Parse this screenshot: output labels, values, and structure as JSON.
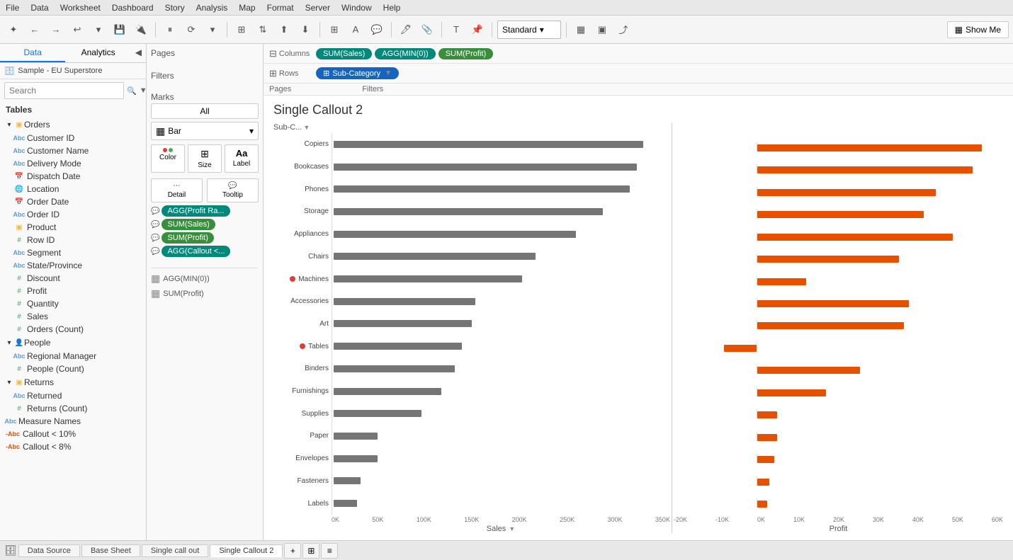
{
  "menu": {
    "items": [
      "File",
      "Data",
      "Worksheet",
      "Dashboard",
      "Story",
      "Analysis",
      "Map",
      "Format",
      "Server",
      "Window",
      "Help"
    ]
  },
  "toolbar": {
    "standard_label": "Standard",
    "show_me_label": "Show Me"
  },
  "left_panel": {
    "tabs": [
      "Data",
      "Analytics"
    ],
    "data_source": "Sample - EU Superstore",
    "search_placeholder": "Search",
    "tables_header": "Tables",
    "orders": {
      "group_label": "Orders",
      "items": [
        {
          "label": "Customer ID",
          "type": "abc"
        },
        {
          "label": "Customer Name",
          "type": "abc"
        },
        {
          "label": "Delivery Mode",
          "type": "abc"
        },
        {
          "label": "Dispatch Date",
          "type": "calendar"
        },
        {
          "label": "Location",
          "type": "globe"
        },
        {
          "label": "Order Date",
          "type": "calendar"
        },
        {
          "label": "Order ID",
          "type": "abc"
        },
        {
          "label": "Product",
          "type": "folder"
        },
        {
          "label": "Row ID",
          "type": "hash"
        },
        {
          "label": "Segment",
          "type": "abc"
        },
        {
          "label": "State/Province",
          "type": "abc"
        },
        {
          "label": "Discount",
          "type": "hash"
        },
        {
          "label": "Profit",
          "type": "hash"
        },
        {
          "label": "Quantity",
          "type": "hash"
        },
        {
          "label": "Sales",
          "type": "hash"
        },
        {
          "label": "Orders (Count)",
          "type": "hash"
        }
      ]
    },
    "people": {
      "group_label": "People",
      "items": [
        {
          "label": "Regional Manager",
          "type": "abc"
        },
        {
          "label": "People (Count)",
          "type": "hash"
        }
      ]
    },
    "returns": {
      "group_label": "Returns",
      "items": [
        {
          "label": "Returned",
          "type": "abc"
        },
        {
          "label": "Returns (Count)",
          "type": "hash"
        }
      ]
    },
    "extra": [
      {
        "label": "Measure Names",
        "type": "abc"
      },
      {
        "label": "Callout < 10%",
        "type": "abc-calc"
      },
      {
        "label": "Callout < 8%",
        "type": "abc-calc"
      }
    ]
  },
  "middle_panel": {
    "pages_label": "Pages",
    "filters_label": "Filters",
    "marks_label": "Marks",
    "marks_all": "All",
    "mark_type": "Bar",
    "mark_buttons": [
      {
        "label": "Color",
        "icon": "⬤⬤"
      },
      {
        "label": "Size",
        "icon": "⊞"
      },
      {
        "label": "Label",
        "icon": "Aa"
      },
      {
        "label": "Detail",
        "icon": "⋯"
      },
      {
        "label": "Tooltip",
        "icon": "💬"
      }
    ],
    "pills": [
      {
        "label": "AGG(Profit Ra...",
        "color": "teal"
      },
      {
        "label": "SUM(Sales)",
        "color": "green"
      },
      {
        "label": "SUM(Profit)",
        "color": "green"
      },
      {
        "label": "AGG(Callout <...",
        "color": "teal"
      }
    ],
    "agg_items": [
      "AGG(MIN(0))",
      "SUM(Profit)"
    ]
  },
  "chart": {
    "title": "Single Callout 2",
    "columns_label": "Columns",
    "rows_label": "Rows",
    "columns_pills": [
      {
        "label": "SUM(Sales)",
        "color": "teal"
      },
      {
        "label": "AGG(MIN(0))",
        "color": "teal"
      },
      {
        "label": "SUM(Profit)",
        "color": "green"
      }
    ],
    "rows_pills": [
      {
        "label": "Sub-Category",
        "color": "blue",
        "has_filter": true
      }
    ],
    "sub_cat_header": "Sub-C...",
    "axis_left": {
      "label": "Sales",
      "ticks": [
        "0K",
        "50K",
        "100K",
        "150K",
        "200K",
        "250K",
        "300K",
        "350K"
      ]
    },
    "axis_right": {
      "label": "Profit",
      "ticks": [
        "-20K",
        "-10K",
        "0K",
        "10K",
        "20K",
        "30K",
        "40K",
        "50K",
        "60K"
      ]
    },
    "categories": [
      {
        "label": "Copiers",
        "dot": false,
        "sales_pct": 0.92,
        "profit_pct": 0.92
      },
      {
        "label": "Bookcases",
        "dot": false,
        "sales_pct": 0.9,
        "profit_pct": 0.88
      },
      {
        "label": "Phones",
        "dot": false,
        "sales_pct": 0.88,
        "profit_pct": 0.73
      },
      {
        "label": "Storage",
        "dot": false,
        "sales_pct": 0.8,
        "profit_pct": 0.68
      },
      {
        "label": "Appliances",
        "dot": false,
        "sales_pct": 0.72,
        "profit_pct": 0.8
      },
      {
        "label": "Chairs",
        "dot": false,
        "sales_pct": 0.6,
        "profit_pct": 0.58
      },
      {
        "label": "Machines",
        "dot": true,
        "sales_pct": 0.56,
        "profit_pct": 0.2
      },
      {
        "label": "Accessories",
        "dot": false,
        "sales_pct": 0.42,
        "profit_pct": 0.62
      },
      {
        "label": "Art",
        "dot": false,
        "sales_pct": 0.41,
        "profit_pct": 0.6
      },
      {
        "label": "Tables",
        "dot": true,
        "sales_pct": 0.38,
        "profit_pct": -0.1
      },
      {
        "label": "Binders",
        "dot": false,
        "sales_pct": 0.36,
        "profit_pct": 0.42
      },
      {
        "label": "Furnishings",
        "dot": false,
        "sales_pct": 0.32,
        "profit_pct": 0.28
      },
      {
        "label": "Supplies",
        "dot": false,
        "sales_pct": 0.26,
        "profit_pct": 0.08
      },
      {
        "label": "Paper",
        "dot": false,
        "sales_pct": 0.13,
        "profit_pct": 0.08
      },
      {
        "label": "Envelopes",
        "dot": false,
        "sales_pct": 0.13,
        "profit_pct": 0.07
      },
      {
        "label": "Fasteners",
        "dot": false,
        "sales_pct": 0.08,
        "profit_pct": 0.05
      },
      {
        "label": "Labels",
        "dot": false,
        "sales_pct": 0.07,
        "profit_pct": 0.04
      }
    ]
  },
  "bottom_tabs": [
    {
      "label": "Data Source",
      "active": false
    },
    {
      "label": "Base Sheet",
      "active": false
    },
    {
      "label": "Single call out",
      "active": false
    },
    {
      "label": "Single Callout 2",
      "active": true
    }
  ]
}
